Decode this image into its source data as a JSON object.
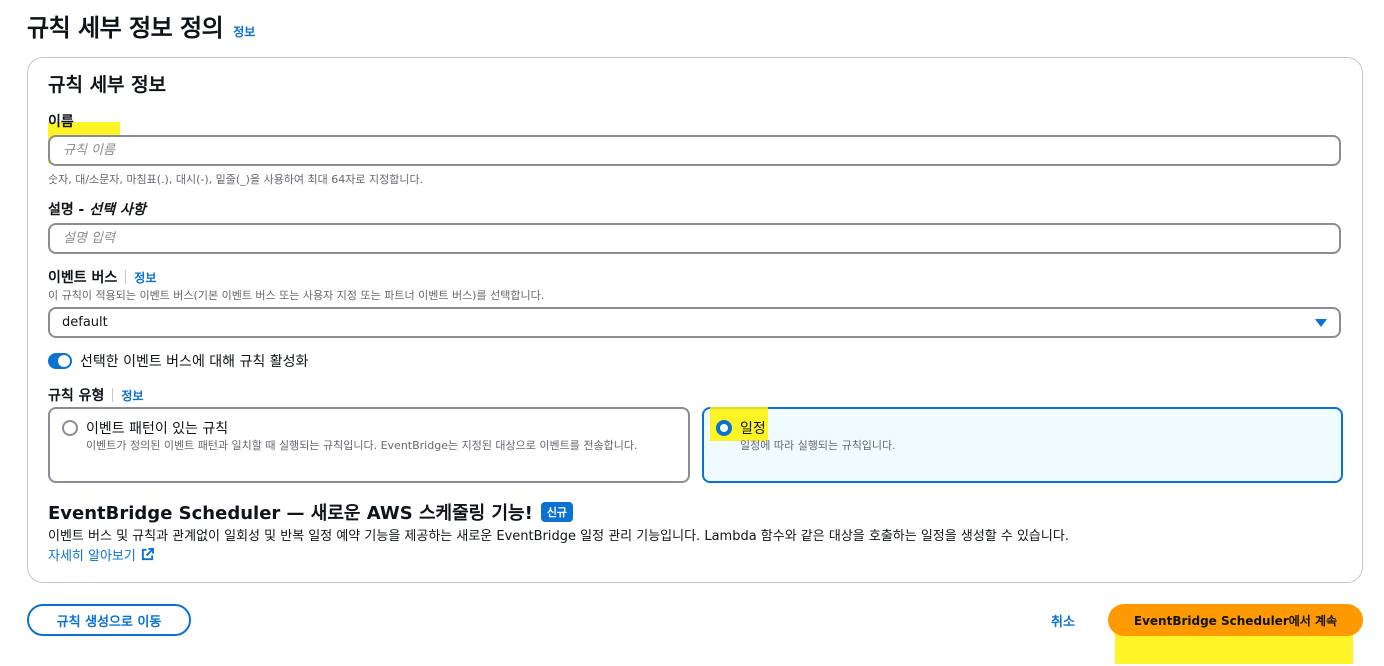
{
  "header": {
    "title": "규칙 세부 정보 정의",
    "info_link": "정보"
  },
  "panel": {
    "title": "규칙 세부 정보",
    "name": {
      "label": "이름",
      "placeholder": "규칙 이름",
      "value": "",
      "hint": "숫자, 대/소문자, 마침표(.), 대시(-), 밑줄(_)을 사용하여 최대 64자로 지정합니다."
    },
    "description": {
      "label": "설명",
      "optional_label": " - 선택 사항",
      "placeholder": "설명 입력",
      "value": ""
    },
    "event_bus": {
      "label": "이벤트 버스",
      "info_link": "정보",
      "hint": "이 규칙이 적용되는 이벤트 버스(기본 이벤트 버스 또는 사용자 지정 또는 파트너 이벤트 버스)를 선택합니다.",
      "selected": "default"
    },
    "enable_toggle": {
      "label": "선택한 이벤트 버스에 대해 규칙 활성화",
      "checked": true
    },
    "rule_type": {
      "label": "규칙 유형",
      "info_link": "정보",
      "options": [
        {
          "title": "이벤트 패턴이 있는 규칙",
          "description": "이벤트가 정의된 이벤트 패턴과 일치할 때 실행되는 규칙입니다. EventBridge는 지정된 대상으로 이벤트를 전송합니다.",
          "selected": false
        },
        {
          "title": "일정",
          "description": "일정에 따라 실행되는 규칙입니다.",
          "selected": true
        }
      ]
    },
    "promo": {
      "title": "EventBridge Scheduler — 새로운 AWS 스케줄링 기능!",
      "badge": "신규",
      "description": "이벤트 버스 및 규칙과 관계없이 일회성 및 반복 일정 예약 기능을 제공하는 새로운 EventBridge 일정 관리 기능입니다. Lambda 함수와 같은 대상을 호출하는 일정을 생성할 수 있습니다.",
      "learn_more": "자세히 알아보기"
    }
  },
  "footer": {
    "continue_rule_label": "규칙 생성으로 이동",
    "cancel_label": "취소",
    "continue_scheduler_label": "EventBridge Scheduler에서 계속"
  },
  "colors": {
    "accent": "#0972d3",
    "primary_button": "#ff9900",
    "highlight": "#fff200"
  }
}
